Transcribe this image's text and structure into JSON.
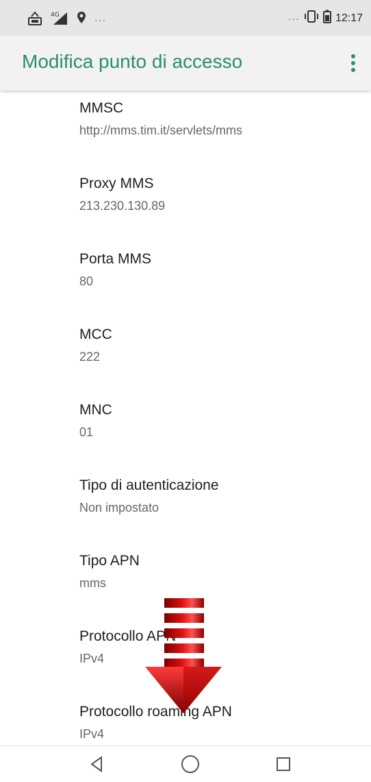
{
  "status_bar": {
    "time": "12:17",
    "more": "···",
    "icons_left": [
      "volte-icon",
      "signal-4g-icon",
      "location-icon"
    ],
    "icons_right": [
      "vibrate-icon",
      "battery-icon"
    ]
  },
  "app_bar": {
    "title": "Modifica punto di accesso",
    "overflow_icon": "more-vert-icon",
    "accent": "#2b8c72"
  },
  "settings": [
    {
      "label": "MMSC",
      "value": "http://mms.tim.it/servlets/mms"
    },
    {
      "label": "Proxy MMS",
      "value": "213.230.130.89"
    },
    {
      "label": "Porta MMS",
      "value": "80"
    },
    {
      "label": "MCC",
      "value": "222"
    },
    {
      "label": "MNC",
      "value": "01"
    },
    {
      "label": "Tipo di autenticazione",
      "value": "Non impostato"
    },
    {
      "label": "Tipo APN",
      "value": "mms"
    },
    {
      "label": "Protocollo APN",
      "value": "IPv4"
    },
    {
      "label": "Protocollo roaming APN",
      "value": "IPv4"
    }
  ],
  "overlay": {
    "icon": "scroll-down-arrow-icon",
    "color": "#cc0000"
  },
  "nav_bar": {
    "back": "back-icon",
    "home": "home-icon",
    "recents": "recents-icon"
  }
}
